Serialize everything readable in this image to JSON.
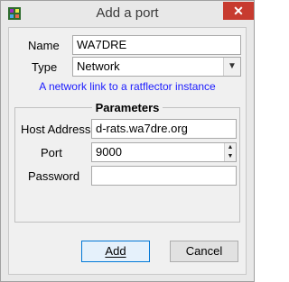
{
  "window": {
    "title": "Add a port",
    "close_glyph": "✕",
    "icon": "d-rats-icon"
  },
  "form": {
    "name_label": "Name",
    "name_value": "WA7DRE",
    "type_label": "Type",
    "type_value": "Network",
    "description": "A network link to a ratflector instance"
  },
  "parameters": {
    "title": "Parameters",
    "host_label": "Host Address",
    "host_value": "d-rats.wa7dre.org",
    "port_label": "Port",
    "port_value": "9000",
    "password_label": "Password",
    "password_value": ""
  },
  "buttons": {
    "add": "Add",
    "cancel": "Cancel"
  },
  "colors": {
    "accent": "#0078d7",
    "description_text": "#1a1aff",
    "close": "#c73b2f"
  }
}
